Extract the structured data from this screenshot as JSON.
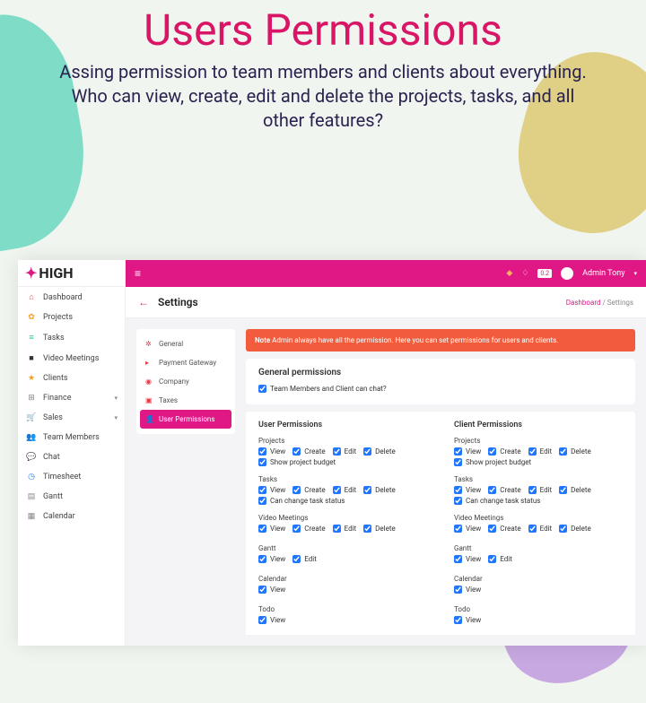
{
  "hero": {
    "title": "Users Permissions",
    "subtitle": "Assing permission to team members and clients about everything. Who can view, create, edit and delete the projects, tasks, and all other features?"
  },
  "logo": "HIGH",
  "nav": [
    {
      "icon": "⌂",
      "label": "Dashboard",
      "color": "c-red"
    },
    {
      "icon": "✿",
      "label": "Projects",
      "color": "c-orange"
    },
    {
      "icon": "≡",
      "label": "Tasks",
      "color": "c-teal"
    },
    {
      "icon": "■",
      "label": "Video Meetings",
      "color": "c-dark"
    },
    {
      "icon": "★",
      "label": "Clients",
      "color": "c-orange"
    },
    {
      "icon": "⊞",
      "label": "Finance",
      "color": "c-gray",
      "caret": true
    },
    {
      "icon": "🛒",
      "label": "Sales",
      "color": "c-green",
      "caret": true
    },
    {
      "icon": "👥",
      "label": "Team Members",
      "color": "c-dark"
    },
    {
      "icon": "💬",
      "label": "Chat",
      "color": "c-red"
    },
    {
      "icon": "◷",
      "label": "Timesheet",
      "color": "c-blue"
    },
    {
      "icon": "▤",
      "label": "Gantt",
      "color": "c-gray"
    },
    {
      "icon": "▦",
      "label": "Calendar",
      "color": "c-gray"
    }
  ],
  "topbar": {
    "user": "Admin Tony",
    "badge": "0.2"
  },
  "page": {
    "title": "Settings",
    "crumb_root": "Dashboard",
    "crumb_leaf": "Settings"
  },
  "tabs": [
    {
      "icon": "✲",
      "label": "General",
      "color": "c-red"
    },
    {
      "icon": "▸",
      "label": "Payment Gateway",
      "color": "c-red"
    },
    {
      "icon": "◉",
      "label": "Company",
      "color": "c-red"
    },
    {
      "icon": "▣",
      "label": "Taxes",
      "color": "c-red"
    },
    {
      "icon": "👤",
      "label": "User Permissions",
      "active": true
    }
  ],
  "alert": {
    "prefix": "Note",
    "text": " Admin always have all the permission. Here you can set permissions for users and clients."
  },
  "general": {
    "heading": "General permissions",
    "chat": "Team Members and Client can chat?"
  },
  "user_heading": "User Permissions",
  "client_heading": "Client Permissions",
  "actions": {
    "view": "View",
    "create": "Create",
    "edit": "Edit",
    "delete": "Delete"
  },
  "groups": {
    "projects": {
      "name": "Projects",
      "extra": "Show project budget"
    },
    "tasks": {
      "name": "Tasks",
      "extra": "Can change task status"
    },
    "video": {
      "name": "Video Meetings"
    },
    "gantt": {
      "name": "Gantt"
    },
    "calendar": {
      "name": "Calendar"
    },
    "todo": {
      "name": "Todo"
    }
  }
}
